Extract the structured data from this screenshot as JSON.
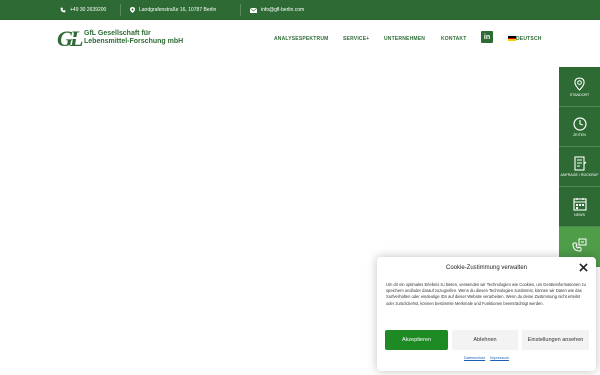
{
  "colors": {
    "brand": "#2e6b34",
    "accent": "#4f9c49",
    "accept": "#1e8a24",
    "link": "#1a5fb4"
  },
  "topbar": {
    "phone": "+49 30 2639200",
    "address": "Landgrafenstraße 16, 10787 Berlin",
    "email": "info@gfl-berlin.com",
    "icons": [
      "phone-icon",
      "location-pin-icon",
      "mail-icon"
    ]
  },
  "logo": {
    "mark": "GfL",
    "line1": "GfL Gesellschaft für",
    "line2": "Lebensmittel-Forschung mbH"
  },
  "nav": {
    "items": [
      {
        "label": "ANALYSESPEKTRUM"
      },
      {
        "label": "SERVICE+"
      },
      {
        "label": "UNTERNEHMEN"
      },
      {
        "label": "KONTAKT"
      }
    ],
    "linkedin": "in",
    "language": "DEUTSCH"
  },
  "sidebar": {
    "items": [
      {
        "label": "STANDORT",
        "icon": "location-pin-icon"
      },
      {
        "label": "ZEITEN",
        "icon": "clock-icon"
      },
      {
        "label": "ANFRAGE / RÜCKRUF",
        "icon": "form-icon"
      },
      {
        "label": "NEWS",
        "icon": "calendar-icon"
      },
      {
        "label": "",
        "icon": "phone-message-icon"
      }
    ]
  },
  "cookie": {
    "title": "Cookie-Zustimmung verwalten",
    "body": "Um dir ein optimales Erlebnis zu bieten, verwenden wir Technologien wie Cookies, um Geräteinformationen zu speichern und/oder darauf zuzugreifen. Wenn du diesen Technologien zustimmst, können wir Daten wie das Surfverhalten oder eindeutige IDs auf dieser Website verarbeiten. Wenn du deine Zustimmung nicht erteilst oder zurückziehst, können bestimmte Merkmale und Funktionen beeinträchtigt werden.",
    "accept": "Akzeptieren",
    "deny": "Ablehnen",
    "settings": "Einstellungen ansehen",
    "link_privacy": "Datenschutz",
    "link_imprint": "Impressum"
  }
}
